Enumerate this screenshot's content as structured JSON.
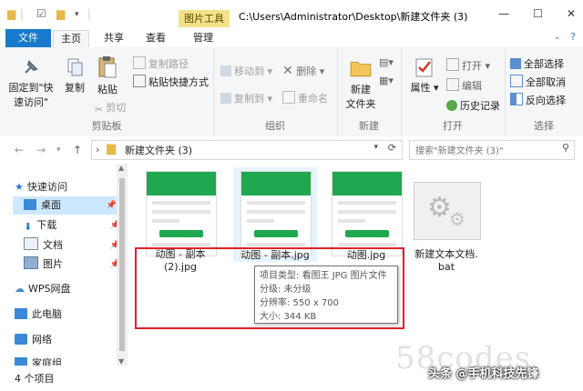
{
  "window": {
    "path_title": "C:\\Users\\Administrator\\Desktop\\新建文件夹 (3)",
    "tool_tab_label": "图片工具",
    "min": "—",
    "max": "☐",
    "close": "✕"
  },
  "tabs": [
    "文件",
    "主页",
    "共享",
    "查看",
    "管理"
  ],
  "ribbon": {
    "clipboard": {
      "label": "剪贴板",
      "pin": "固定到\"快\n速访问\"",
      "copy": "复制",
      "paste": "粘贴",
      "copy_path": "复制路径",
      "paste_shortcut": "粘贴快捷方式",
      "cut": "剪切"
    },
    "organize": {
      "label": "组织",
      "move_to": "移动到",
      "copy_to": "复制到",
      "delete": "删除",
      "rename": "重命名"
    },
    "new": {
      "label": "新建",
      "new_folder": "新建\n文件夹"
    },
    "open": {
      "label": "打开",
      "properties": "属性",
      "open": "打开",
      "edit": "编辑",
      "history": "历史记录"
    },
    "select": {
      "label": "选择",
      "select_all": "全部选择",
      "select_none": "全部取消",
      "invert": "反向选择"
    }
  },
  "address": {
    "path": "新建文件夹 (3)",
    "search_placeholder": "搜索\"新建文件夹 (3)\""
  },
  "nav": {
    "items": [
      {
        "label": "快速访问"
      },
      {
        "label": "桌面"
      },
      {
        "label": "下载"
      },
      {
        "label": "文档"
      },
      {
        "label": "图片"
      },
      {
        "label": "WPS网盘"
      },
      {
        "label": "此电脑"
      },
      {
        "label": "网络"
      },
      {
        "label": "家庭组"
      }
    ]
  },
  "files": [
    {
      "name": "动图 - 副本\n(2).jpg"
    },
    {
      "name": "动图 - 副本.jpg"
    },
    {
      "name": "动图.jpg"
    },
    {
      "name": "新建文本文档.\nbat"
    }
  ],
  "tooltip": {
    "type": "项目类型: 看图王 JPG 图片文件",
    "rating": "分级: 未分级",
    "resolution": "分辨率: 550 x 700",
    "size": "大小: 344 KB"
  },
  "status": {
    "count": "4 个项目"
  },
  "watermark": "58codes",
  "credit": "头条 @手机科技先锋"
}
